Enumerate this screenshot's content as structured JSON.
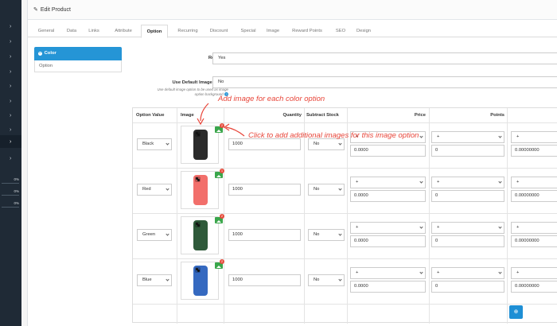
{
  "panel": {
    "title": "Edit Product"
  },
  "tabs": [
    "General",
    "Data",
    "Links",
    "Attribute",
    "Option",
    "Recurring",
    "Discount",
    "Special",
    "Image",
    "Reward Points",
    "SEO",
    "Design"
  ],
  "active_tab": "Option",
  "options": {
    "color_label": "Color",
    "option_label": "Option"
  },
  "form": {
    "required_label": "Required",
    "required_value": "Yes",
    "default_image_label": "Use Default Image Option",
    "default_image_value": "No",
    "default_image_help": "Use default image option to be used as image option background"
  },
  "table": {
    "headers": [
      "Option Value",
      "Image",
      "Quantity",
      "Subtract Stock",
      "Price",
      "Points"
    ],
    "rows": [
      {
        "value": "Black",
        "quantity": "1000",
        "subtract": "No",
        "price_prefix": "+",
        "price": "0.0000",
        "points_prefix": "+",
        "points": "0",
        "weight_prefix": "+",
        "weight": "0.00000000",
        "phone_color": "#2b2b2b",
        "badge": "2"
      },
      {
        "value": "Red",
        "quantity": "1000",
        "subtract": "No",
        "price_prefix": "+",
        "price": "0.0000",
        "points_prefix": "+",
        "points": "0",
        "weight_prefix": "+",
        "weight": "0.00000000",
        "phone_color": "#f26f6b",
        "badge": "1"
      },
      {
        "value": "Green",
        "quantity": "1000",
        "subtract": "No",
        "price_prefix": "+",
        "price": "0.0000",
        "points_prefix": "+",
        "points": "0",
        "weight_prefix": "+",
        "weight": "0.00000000",
        "phone_color": "#2f5a3a",
        "badge": "2"
      },
      {
        "value": "Blue",
        "quantity": "1000",
        "subtract": "No",
        "price_prefix": "+",
        "price": "0.0000",
        "points_prefix": "+",
        "points": "0",
        "weight_prefix": "+",
        "weight": "0.00000000",
        "phone_color": "#3569c0",
        "badge": "2"
      }
    ]
  },
  "annotations": {
    "image_note": "Add image for each color option",
    "additional_note": "Click to add additional images for this image option"
  },
  "sidebar_stats": [
    "0%",
    "0%",
    "0%"
  ],
  "colors": {
    "accent": "#2595d6",
    "nav": "#1f2a36",
    "annotation": "#e8463a",
    "add_image": "#3aa64b"
  }
}
